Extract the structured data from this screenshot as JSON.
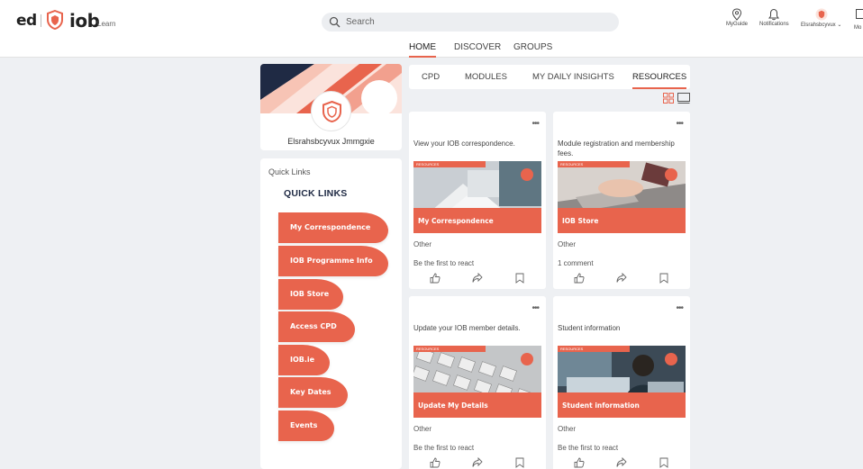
{
  "brand": {
    "ed": "ed",
    "iob": "iob",
    "learn": "Learn"
  },
  "search": {
    "placeholder": "Search"
  },
  "header_icons": [
    {
      "label": "MyGuide",
      "icon": "location-pin-icon"
    },
    {
      "label": "Notifications",
      "icon": "bell-icon"
    },
    {
      "label": "Elsrahsbcyvux",
      "icon": "user-avatar-icon"
    },
    {
      "label": "Mo",
      "icon": "more-icon"
    }
  ],
  "nav": {
    "tabs": [
      "HOME",
      "DISCOVER",
      "GROUPS"
    ],
    "active": "HOME"
  },
  "profile": {
    "name": "Elsrahsbcyvux Jmmgxie"
  },
  "quick_links": {
    "small_title": "Quick Links",
    "title": "QUICK LINKS",
    "items": [
      "My Correspondence",
      "IOB Programme Info",
      "IOB Store",
      "Access CPD",
      "IOB.ie",
      "Key Dates",
      "Events"
    ]
  },
  "resource_tabs": {
    "tabs": [
      "CPD",
      "MODULES",
      "MY DAILY INSIGHTS",
      "RESOURCES"
    ],
    "active": "RESOURCES"
  },
  "cards": [
    {
      "description": "View your IOB correspondence.",
      "tag": "RESOURCES",
      "title": "My Correspondence",
      "category": "Other",
      "reactions": "Be the first to react"
    },
    {
      "description": "Module registration and membership fees.",
      "tag": "RESOURCES",
      "title": "IOB Store",
      "category": "Other",
      "reactions": "1 comment"
    },
    {
      "description": "Update your IOB member details.",
      "tag": "RESOURCES",
      "title": "Update My Details",
      "category": "Other",
      "reactions": "Be the first to react"
    },
    {
      "description": "Student information",
      "tag": "RESOURCES",
      "title": "Student information",
      "category": "Other",
      "reactions": "Be the first to react"
    }
  ],
  "colors": {
    "accent": "#e8644d",
    "navy": "#1f2a44",
    "background": "#eef0f3"
  }
}
